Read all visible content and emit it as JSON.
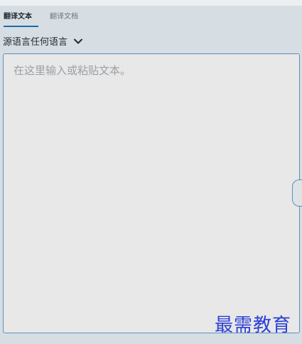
{
  "tabs": {
    "text": "翻译文本",
    "document": "翻译文档"
  },
  "source_language": {
    "label": "源语言任何语言",
    "icon": "chevron-down-icon"
  },
  "input": {
    "placeholder": "在这里输入或粘贴文本。",
    "value": ""
  },
  "watermark": "最需教育",
  "colors": {
    "accent": "#1b6ca8",
    "border": "#5b8fbf",
    "watermark": "#2b3fd6"
  }
}
